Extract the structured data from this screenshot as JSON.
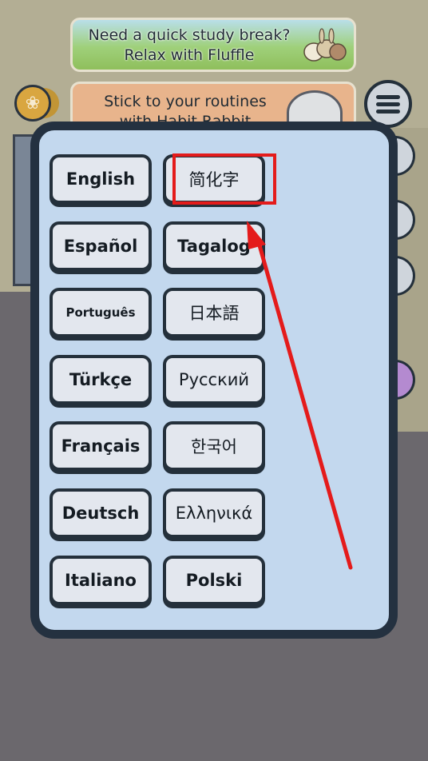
{
  "banners": {
    "study_break_line1": "Need a quick study break?",
    "study_break_line2": "Relax with Fluffle",
    "routines_line1": "Stick to your routines",
    "routines_line2": "with Habit Rabbit"
  },
  "languages": [
    {
      "label": "English"
    },
    {
      "label": "简化字"
    },
    {
      "label": "Español"
    },
    {
      "label": "Tagalog"
    },
    {
      "label": "Português"
    },
    {
      "label": "日本語"
    },
    {
      "label": "Türkçe"
    },
    {
      "label": "Русский"
    },
    {
      "label": "Français"
    },
    {
      "label": "한국어"
    },
    {
      "label": "Deutsch"
    },
    {
      "label": "Ελληνικά"
    },
    {
      "label": "Italiano"
    },
    {
      "label": "Polski"
    }
  ],
  "highlighted_language": "简化字",
  "colors": {
    "highlight": "#e41b1b",
    "dialog_bg": "#c3d8ee",
    "dialog_border": "#243140",
    "button_bg": "#e3e7ee"
  },
  "icons": {
    "coin": "rabbit-coin-icon",
    "menu": "hamburger-menu-icon",
    "arrow": "red-pointer-arrow"
  }
}
